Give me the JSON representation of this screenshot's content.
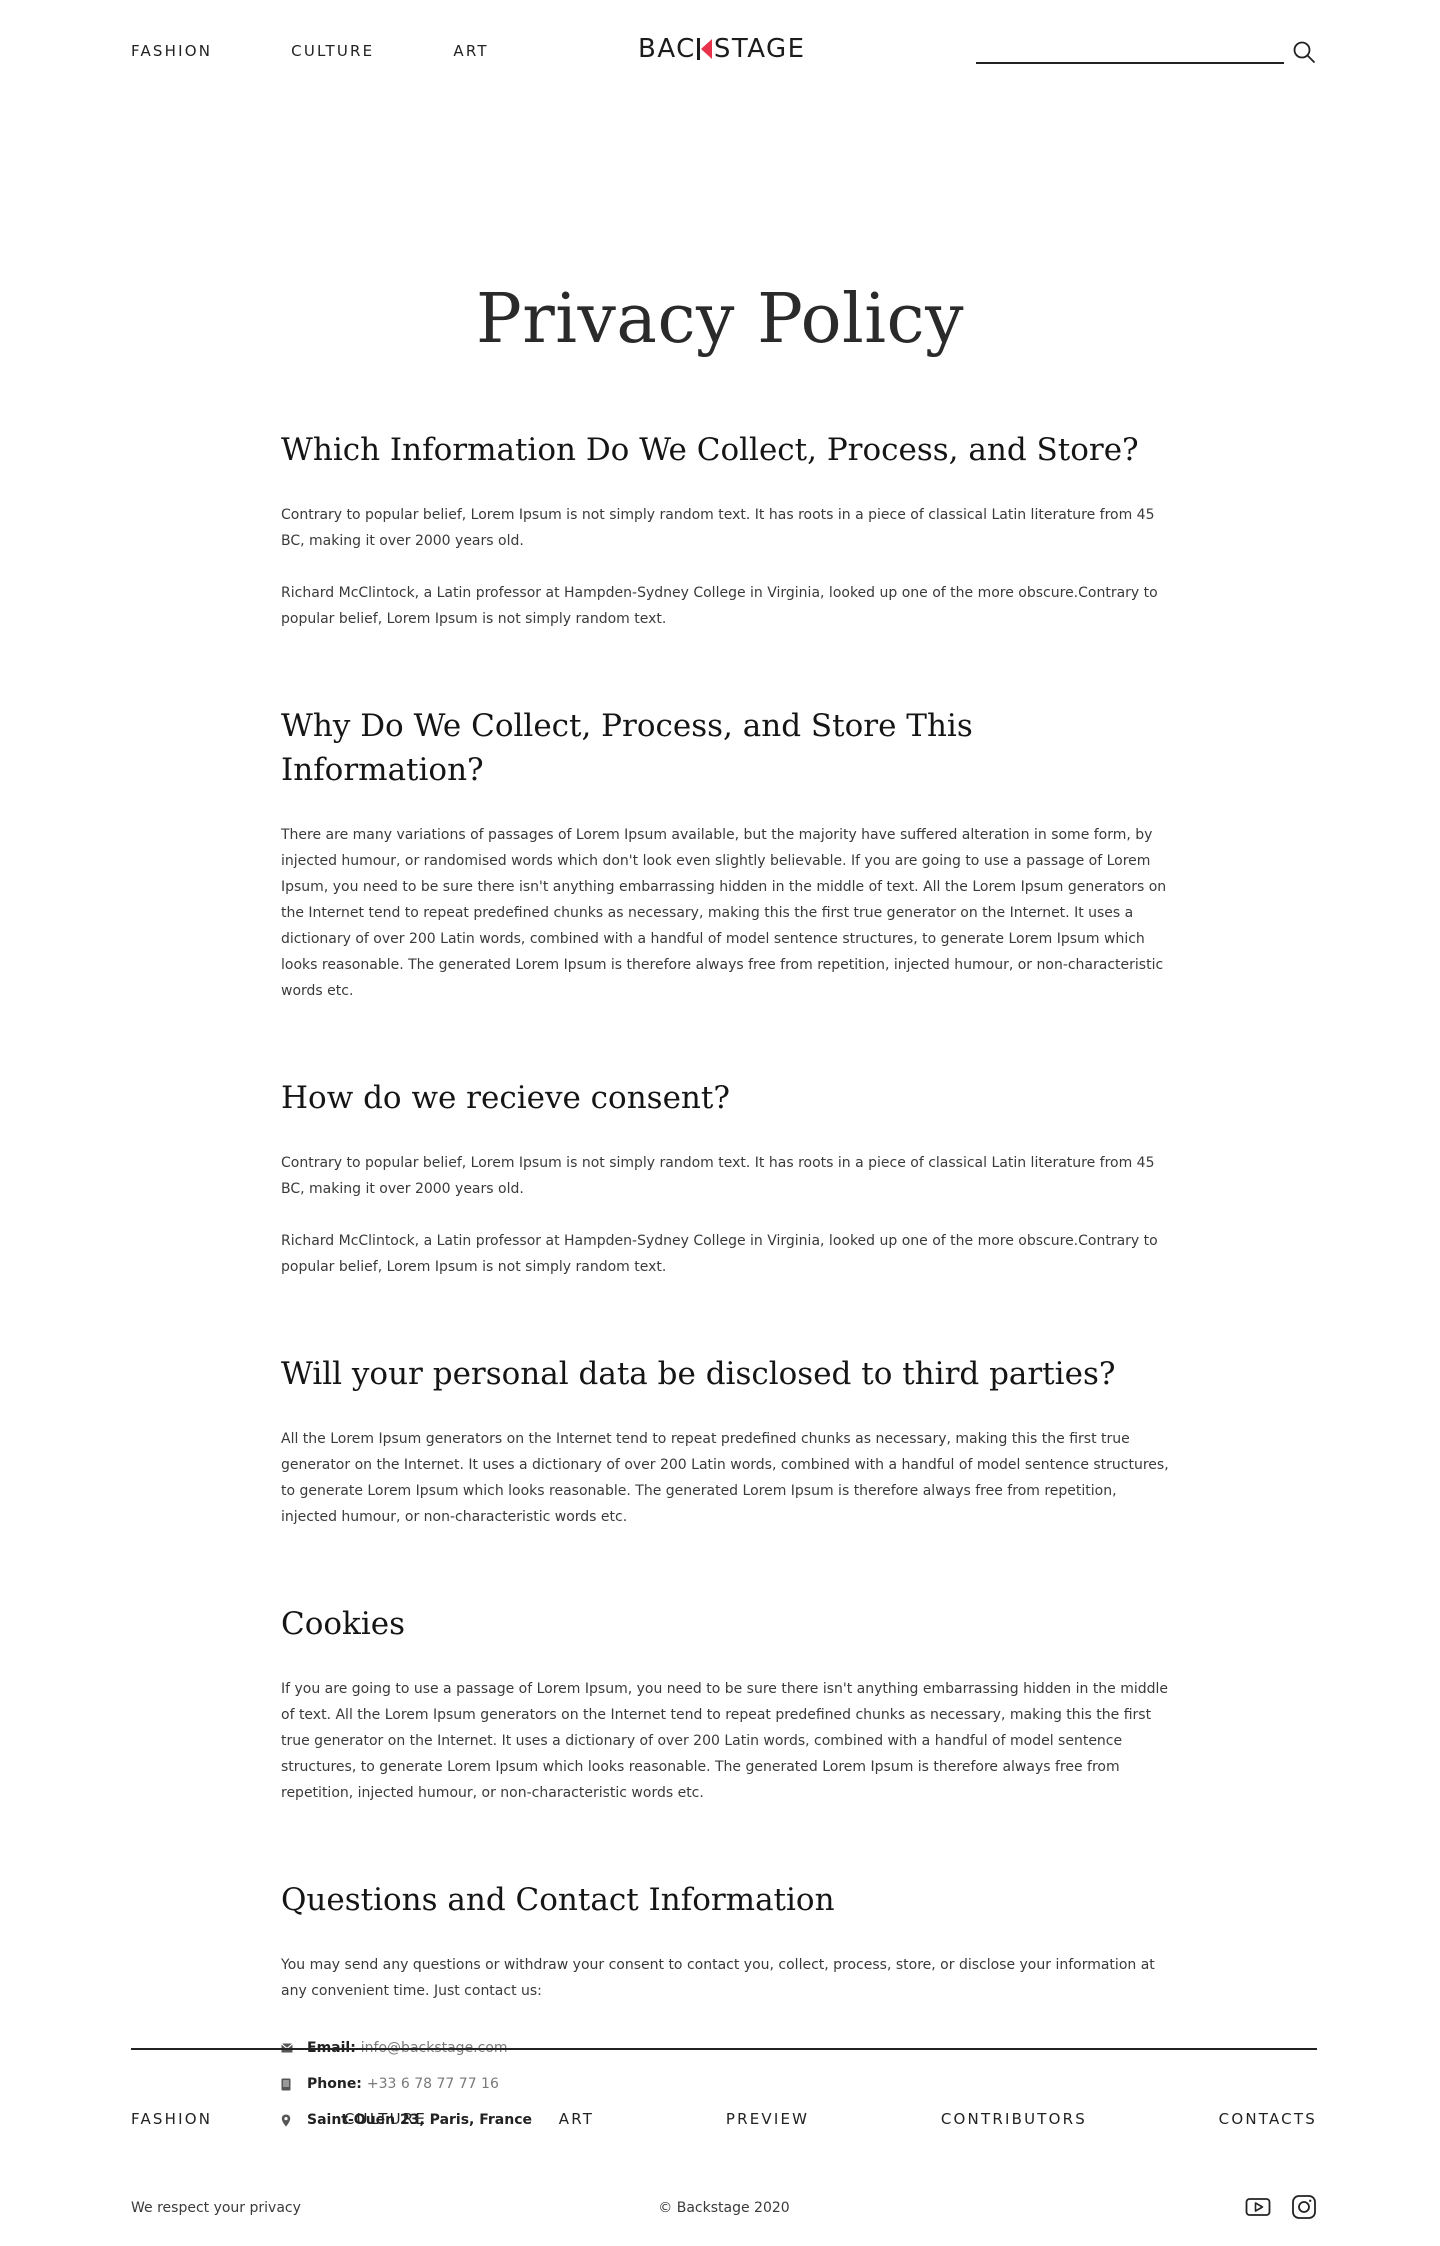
{
  "header": {
    "nav": [
      "FASHION",
      "CULTURE",
      "ART"
    ],
    "logo_left": "BAC",
    "logo_right": "STAGE",
    "search_placeholder": "",
    "search_value": ""
  },
  "page_title": "Privacy Policy",
  "sections": [
    {
      "heading": "Which Information Do We Collect, Process, and Store?",
      "paragraphs": [
        "Contrary to popular belief, Lorem Ipsum is not simply random text. It has roots in a piece of classical Latin literature from 45 BC, making it over 2000 years old.",
        "Richard McClintock, a Latin professor at Hampden-Sydney College in Virginia, looked up one of the more obscure.Contrary to popular belief, Lorem Ipsum is not simply random text."
      ]
    },
    {
      "heading": "Why Do We Collect, Process, and Store This Information?",
      "paragraphs": [
        "There are many variations of passages of Lorem Ipsum available, but the majority have suffered alteration in some form, by injected humour, or randomised words which don't look even slightly believable. If you are going to use a passage of Lorem Ipsum, you need to be sure there isn't anything embarrassing hidden in the middle of text. All the Lorem Ipsum generators on the Internet tend to repeat predefined chunks as necessary, making this the first true generator on the Internet. It uses a dictionary of over 200 Latin words, combined with a handful of model sentence structures, to generate Lorem Ipsum which looks reasonable. The generated Lorem Ipsum is therefore always free from repetition, injected humour, or non-characteristic words etc."
      ]
    },
    {
      "heading": "How do we recieve consent?",
      "paragraphs": [
        "Contrary to popular belief, Lorem Ipsum is not simply random text. It has roots in a piece of classical Latin literature from 45 BC, making it over 2000 years old.",
        "Richard McClintock, a Latin professor at Hampden-Sydney College in Virginia, looked up one of the more obscure.Contrary to popular belief, Lorem Ipsum is not simply random text."
      ]
    },
    {
      "heading": "Will your personal data be disclosed to third parties?",
      "paragraphs": [
        "All the Lorem Ipsum generators on the Internet tend to repeat predefined chunks as necessary, making this the first true generator on the Internet. It uses a dictionary of over 200 Latin words, combined with a handful of model sentence structures, to generate Lorem Ipsum which looks reasonable. The generated Lorem Ipsum is therefore always free from repetition, injected humour, or non-characteristic words etc."
      ]
    },
    {
      "heading": "Cookies",
      "paragraphs": [
        "If you are going to use a passage of Lorem Ipsum, you need to be sure there isn't anything embarrassing hidden in the middle of text. All the Lorem Ipsum generators on the Internet tend to repeat predefined chunks as necessary, making this the first true generator on the Internet. It uses a dictionary of over 200 Latin words, combined with a handful of model sentence structures, to generate Lorem Ipsum which looks reasonable. The generated Lorem Ipsum is therefore always free from repetition, injected humour, or non-characteristic words etc."
      ]
    },
    {
      "heading": "Questions and Contact Information",
      "paragraphs": [
        "You may send any questions or withdraw your consent to contact you, collect, process, store, or disclose your information at any convenient time. Just contact us:"
      ]
    }
  ],
  "contact": {
    "email_label": "Email:",
    "email_value": "info@backstage.com",
    "phone_label": "Phone:",
    "phone_value": "+33 6 78 77 77 16",
    "address": "Saint-Ouen 23, Paris, France"
  },
  "footer": {
    "nav": [
      "FASHION",
      "CULTURE",
      "ART",
      "PREVIEW",
      "CONTRIBUTORS",
      "CONTACTS"
    ],
    "privacy_note": "We respect your privacy",
    "copyright": "© Backstage 2020",
    "social_icons": [
      "youtube-icon",
      "instagram-icon"
    ]
  },
  "colors": {
    "accent": "#e8334a",
    "text": "#2b2b2b",
    "muted": "#7a7a7a"
  }
}
